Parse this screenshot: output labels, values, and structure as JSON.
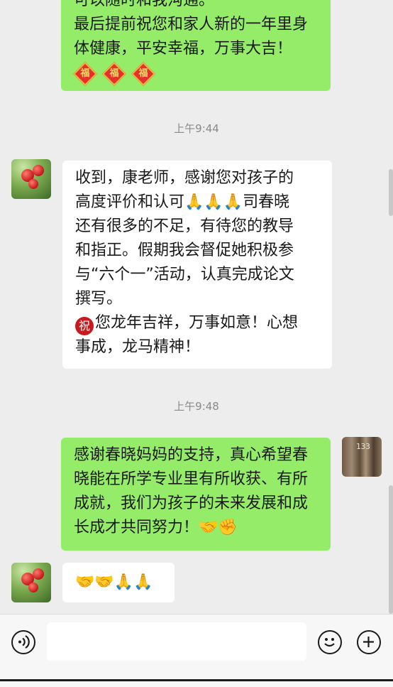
{
  "messages": [
    {
      "id": "m1",
      "direction": "outgoing",
      "lines": [
        "可以随时和我沟通。",
        "最后提前祝您和家人新的一年里身",
        "体健康，平安幸福，万事大吉！"
      ],
      "emoji": [
        "福",
        "福",
        "福"
      ]
    },
    {
      "id": "t1",
      "type": "timestamp",
      "text": "上午9:44"
    },
    {
      "id": "m2",
      "direction": "incoming",
      "lines": [
        "收到，康老师，感谢您对孩子的",
        "高度评价和认可🙏🙏🙏司春晓",
        "还有很多的不足，有待您的教导",
        "和指正。假期我会督促她积极参",
        "与“六个一”活动，认真完成论文",
        "撰写。"
      ],
      "badge": "祝",
      "wish_lines": [
        "您龙年吉祥，万事如意！心想",
        "事成，龙马精神！"
      ]
    },
    {
      "id": "t2",
      "type": "timestamp",
      "text": "上午9:48"
    },
    {
      "id": "m3",
      "direction": "outgoing",
      "lines": [
        "感谢春晓妈妈的支持，真心希望春",
        "晓能在所学专业里有所收获、有所",
        "成就，我们为孩子的未来发展和成",
        "长成才共同努力！🤝✊"
      ]
    },
    {
      "id": "m4",
      "direction": "incoming",
      "lines": [
        "🤝🤝🙏🙏"
      ]
    }
  ],
  "avatars": {
    "self_text": "133"
  },
  "input": {
    "placeholder": "",
    "value": ""
  },
  "icons": {
    "voice": "voice-icon",
    "emoji": "emoji-icon",
    "add": "plus-icon"
  }
}
